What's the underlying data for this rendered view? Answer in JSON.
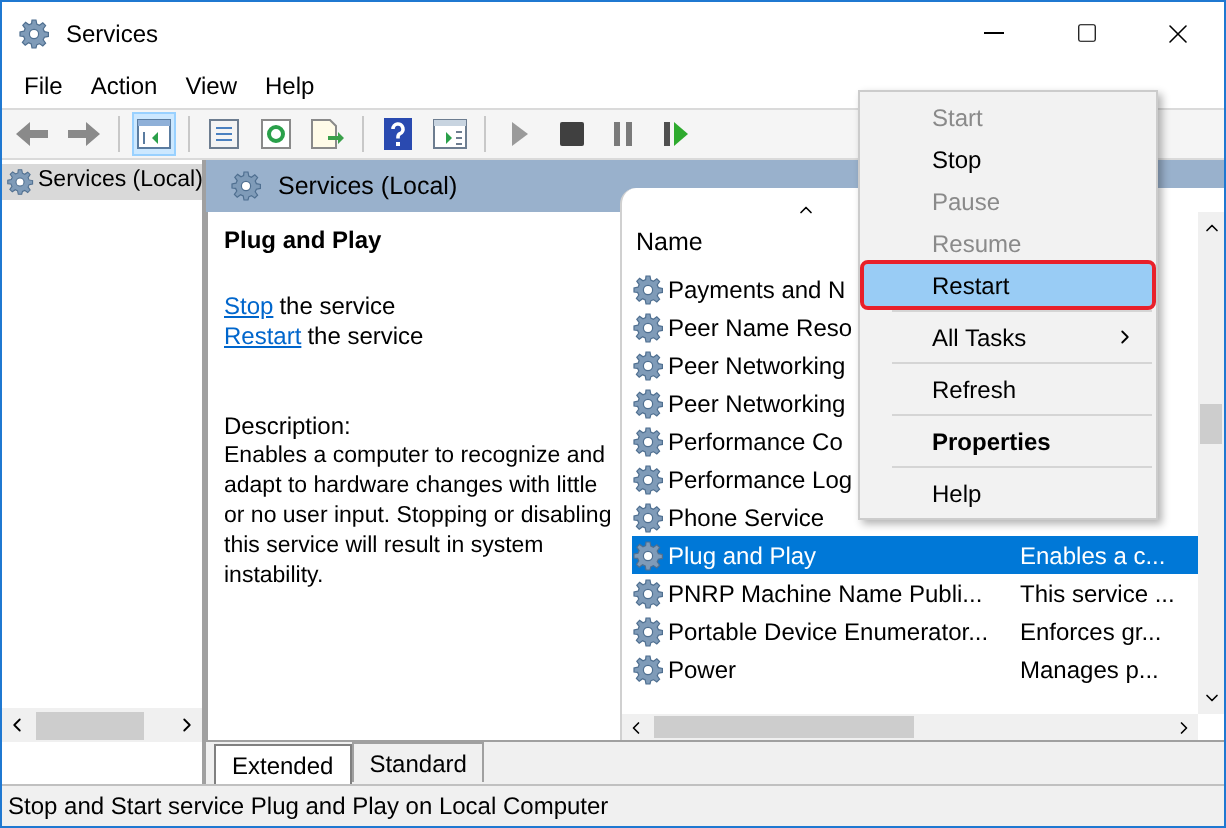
{
  "window": {
    "title": "Services"
  },
  "menu_bar": [
    "File",
    "Action",
    "View",
    "Help"
  ],
  "toolbar": [
    {
      "kind": "back",
      "selected": false
    },
    {
      "kind": "forward",
      "selected": false
    },
    {
      "kind": "tree",
      "selected": true
    },
    {
      "kind": "properties",
      "selected": false
    },
    {
      "kind": "refresh",
      "selected": false
    },
    {
      "kind": "export",
      "selected": false
    },
    {
      "kind": "help",
      "selected": false
    },
    {
      "kind": "panel",
      "selected": false
    },
    {
      "kind": "start",
      "selected": false
    },
    {
      "kind": "stop",
      "selected": false
    },
    {
      "kind": "pause",
      "selected": false
    },
    {
      "kind": "restart",
      "selected": false
    }
  ],
  "tree": [
    {
      "label": "Services (Local)",
      "selected": true
    }
  ],
  "pane_header": "Services (Local)",
  "details": {
    "title": "Plug and Play",
    "actions": [
      {
        "link": "Stop",
        "text": "the service"
      },
      {
        "link": "Restart",
        "text": "the service"
      }
    ],
    "description_label": "Description:",
    "description": "Enables a computer to recognize and adapt to hardware changes with little or no user input. Stopping or disabling this service will result in system instability."
  },
  "list": {
    "columns": [
      "Name"
    ],
    "rows": [
      {
        "name": "Payments and N",
        "selected": false
      },
      {
        "name": "Peer Name Reso",
        "selected": false
      },
      {
        "name": "Peer Networking",
        "selected": false
      },
      {
        "name": "Peer Networking",
        "selected": false
      },
      {
        "name": "Performance Co",
        "selected": false
      },
      {
        "name": "Performance Log",
        "selected": false
      },
      {
        "name": "Phone Service",
        "selected": false
      },
      {
        "name": "Plug and Play",
        "description": "Enables a c...",
        "selected": true
      },
      {
        "name": "PNRP Machine Name Publi...",
        "description": "This service ...",
        "selected": false
      },
      {
        "name": "Portable Device Enumerator...",
        "description": "Enforces gr...",
        "selected": false
      },
      {
        "name": "Power",
        "description": "Manages p...",
        "selected": false
      }
    ]
  },
  "context_menu": [
    {
      "kind": "item",
      "label": "Start",
      "disabled": true,
      "bold": false,
      "highlighted": false
    },
    {
      "kind": "item",
      "label": "Stop",
      "disabled": false,
      "bold": false,
      "highlighted": false
    },
    {
      "kind": "item",
      "label": "Pause",
      "disabled": true,
      "bold": false,
      "highlighted": false
    },
    {
      "kind": "item",
      "label": "Resume",
      "disabled": true,
      "bold": false,
      "highlighted": false
    },
    {
      "kind": "item",
      "label": "Restart",
      "disabled": false,
      "bold": false,
      "highlighted": true
    },
    {
      "kind": "separator"
    },
    {
      "kind": "submenu",
      "label": "All Tasks",
      "disabled": false,
      "bold": false,
      "highlighted": false
    },
    {
      "kind": "separator"
    },
    {
      "kind": "item",
      "label": "Refresh",
      "disabled": false,
      "bold": false,
      "highlighted": false
    },
    {
      "kind": "separator"
    },
    {
      "kind": "item",
      "label": "Properties",
      "disabled": false,
      "bold": true,
      "highlighted": false
    },
    {
      "kind": "separator"
    },
    {
      "kind": "item",
      "label": "Help",
      "disabled": false,
      "bold": false,
      "highlighted": false
    }
  ],
  "tabs": [
    {
      "label": "Extended",
      "selected": true
    },
    {
      "label": "Standard",
      "selected": false
    }
  ],
  "status_bar": "Stop and Start service Plug and Play on Local Computer"
}
